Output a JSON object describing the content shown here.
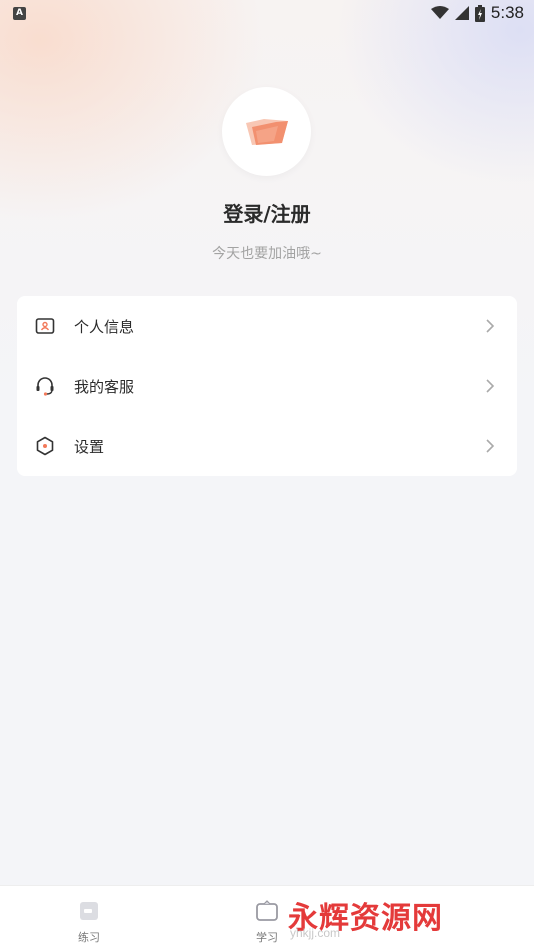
{
  "status_bar": {
    "time": "5:38",
    "app_icon": "A"
  },
  "profile": {
    "login_title": "登录/注册",
    "subtitle": "今天也要加油哦~"
  },
  "menu": {
    "items": [
      {
        "label": "个人信息",
        "icon": "id-card-icon"
      },
      {
        "label": "我的客服",
        "icon": "headset-icon"
      },
      {
        "label": "设置",
        "icon": "hexagon-settings-icon"
      }
    ]
  },
  "tabbar": {
    "tabs": [
      {
        "label": "练习",
        "icon": "practice-icon"
      },
      {
        "label": "学习",
        "icon": "study-icon"
      }
    ]
  },
  "watermark": {
    "text": "永辉资源网",
    "sub": "yhkjj.com"
  },
  "colors": {
    "accent": "#f2795a",
    "text": "#2b2b2b",
    "muted": "#a3a3a3"
  }
}
